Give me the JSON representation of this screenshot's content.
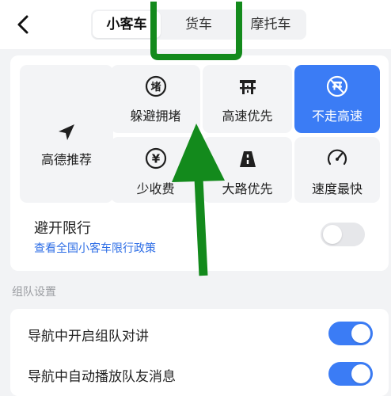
{
  "header": {
    "back_icon": "chevron-left-icon",
    "tabs": [
      {
        "label": "小客车",
        "active": true
      },
      {
        "label": "货车",
        "active": false
      },
      {
        "label": "摩托车",
        "active": false
      }
    ]
  },
  "route_prefs": {
    "tiles": [
      {
        "label": "高德推荐",
        "icon": "navigation-arrow-icon",
        "active": false
      },
      {
        "label": "躲避拥堵",
        "icon": "congestion-avoid-icon",
        "icon_char": "堵",
        "active": false
      },
      {
        "label": "高速优先",
        "icon": "highway-icon",
        "active": false
      },
      {
        "label": "不走高速",
        "icon": "no-highway-icon",
        "active": true
      },
      {
        "label": "少收费",
        "icon": "yuan-icon",
        "icon_char": "¥",
        "active": false
      },
      {
        "label": "大路优先",
        "icon": "main-road-icon",
        "active": false
      },
      {
        "label": "速度最快",
        "icon": "speedometer-icon",
        "active": false
      }
    ],
    "restriction": {
      "title": "避开限行",
      "link": "查看全国小客车限行政策",
      "enabled": false
    }
  },
  "team": {
    "section_label": "组队设置",
    "rows": [
      {
        "label": "导航中开启组队对讲",
        "enabled": true
      },
      {
        "label": "导航中自动播放队友消息",
        "enabled": true
      }
    ]
  },
  "colors": {
    "accent": "#3b7cf5",
    "link": "#2e6ee6",
    "annotation": "#138a1c"
  }
}
